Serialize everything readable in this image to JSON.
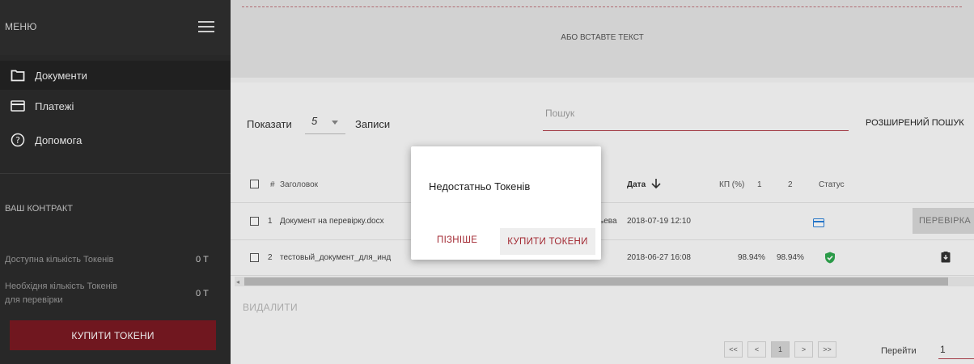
{
  "sidebar": {
    "title": "МЕНЮ",
    "items": [
      {
        "label": "Документи",
        "icon": "folder-icon"
      },
      {
        "label": "Платежі",
        "icon": "credit-card-icon"
      },
      {
        "label": "Допомога",
        "icon": "help-icon"
      }
    ],
    "contract_title": "ВАШ КОНТРАКТ",
    "available_tokens_label": "Доступна кількість Токенів",
    "available_tokens_value": "0 Т",
    "required_tokens_label_line1": "Необхідня кількість Токенів",
    "required_tokens_label_line2": "для перевірки",
    "required_tokens_value": "0 Т",
    "buy_tokens_label": "КУПИТИ ТОКЕНИ"
  },
  "paste_zone": {
    "text": "АБО ВСТАВТЕ ТЕКСТ"
  },
  "toolbar": {
    "show_label": "Показати",
    "page_size": "5",
    "records_label": "Записи",
    "search_placeholder": "Пошук",
    "advanced_search_label": "РОЗШИРЕНИЙ ПОШУК"
  },
  "table": {
    "headers": {
      "number": "#",
      "title": "Заголовок",
      "date": "Дата",
      "kp": "КП (%)",
      "col1": "1",
      "col2": "2",
      "status": "Статус"
    },
    "rows": [
      {
        "num": "1",
        "title": "Документ на перевірку.docx",
        "author_fragment": "ьева",
        "date": "2018-07-19 12:10",
        "kp1": "",
        "kp2": "",
        "status_icon": "card-status-icon",
        "action": "ПЕРЕВІРКА"
      },
      {
        "num": "2",
        "title": "тестовый_документ_для_инд",
        "author_fragment": "",
        "date": "2018-06-27 16:08",
        "kp1": "98.94%",
        "kp2": "98.94%",
        "status_icon": "check-shield-icon",
        "action_icon": "download-icon"
      }
    ]
  },
  "delete_label": "ВИДАЛИТИ",
  "pagination": {
    "first": "<<",
    "prev": "<",
    "current": "1",
    "next": ">",
    "last": ">>",
    "goto_label": "Перейти",
    "goto_value": "1"
  },
  "dialog": {
    "message": "Недостатньо Токенів",
    "later_label": "ПІЗНІШЕ",
    "buy_label": "КУПИТИ ТОКЕНИ"
  },
  "colors": {
    "accent": "#a32a33",
    "sidebar_bg": "#2c2c2c",
    "buy_button_bg": "#7a1a22",
    "status_blue": "#2a7fd8",
    "status_green": "#2fa84f"
  }
}
